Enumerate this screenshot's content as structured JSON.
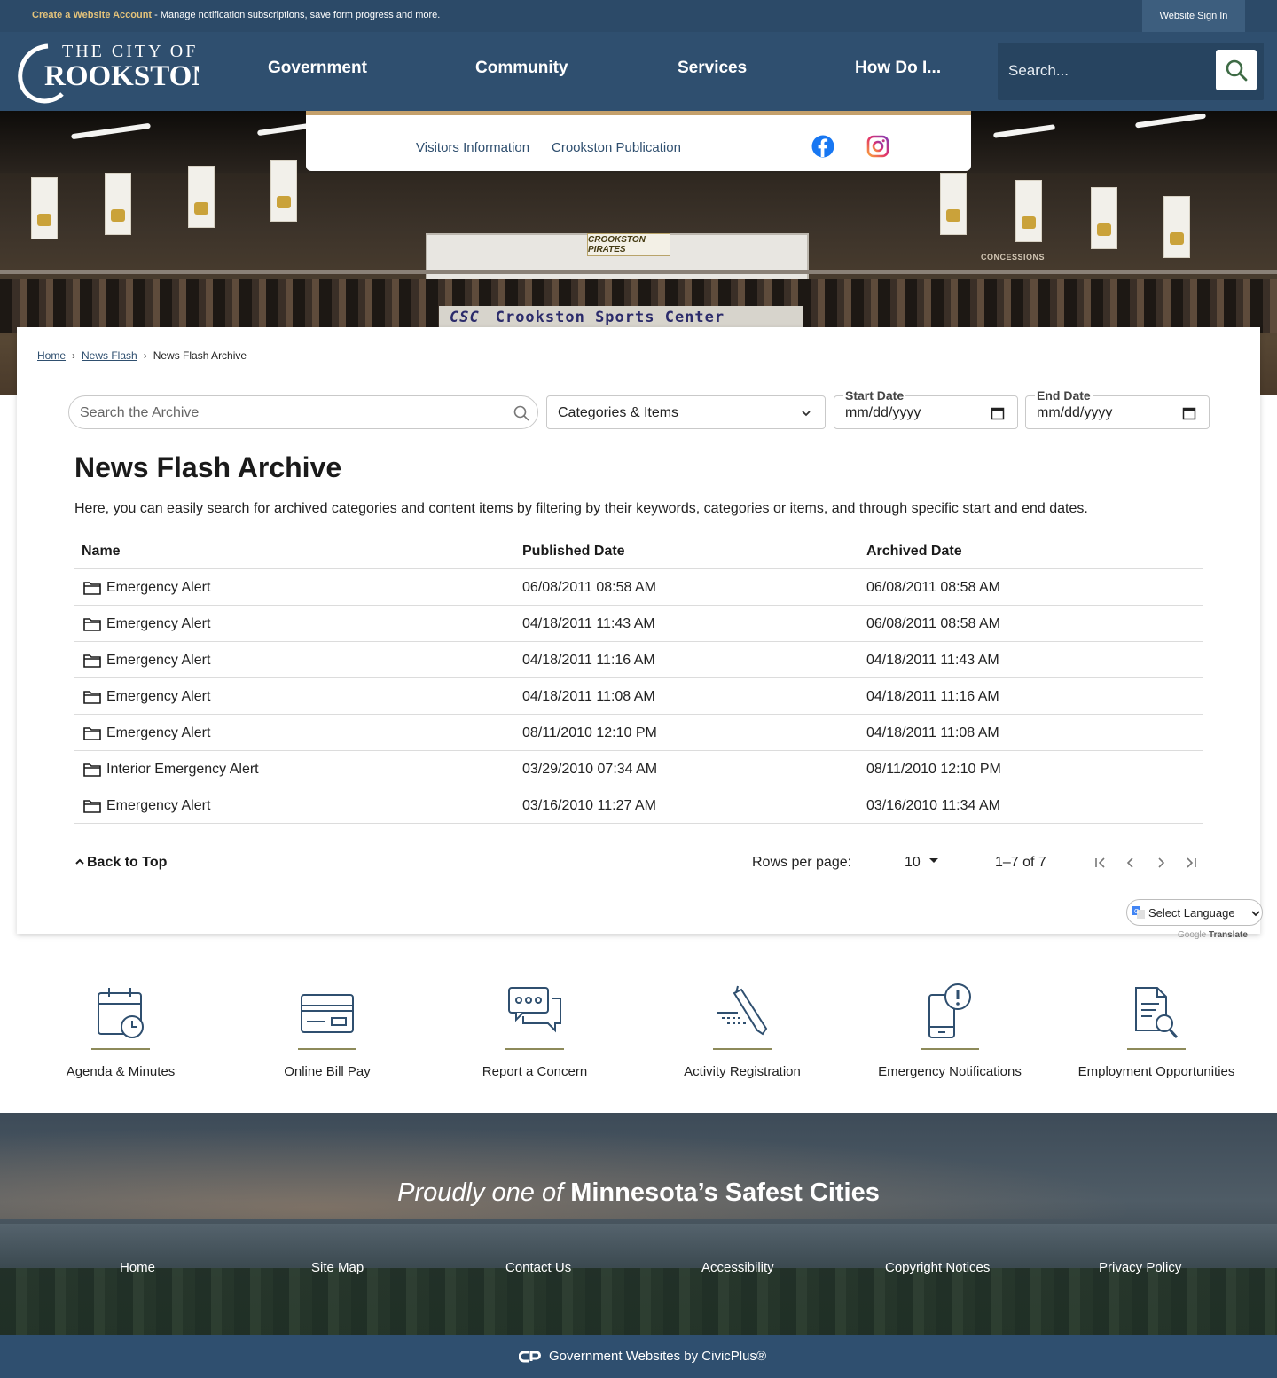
{
  "topbar": {
    "create_link": "Create a Website Account",
    "message": " - Manage notification subscriptions, save form progress and more.",
    "signin_label": "Website Sign In"
  },
  "header": {
    "logo_line1": "THE CITY OF",
    "logo_line2": "ROOKSTON",
    "logo_initial": "C",
    "nav": [
      "Government",
      "Community",
      "Services",
      "How Do I..."
    ],
    "search_placeholder": "Search..."
  },
  "hero": {
    "sign_text": "Crookston Sports Center",
    "sign_prefix": "CSC",
    "booth_text": "CROOKSTON PIRATES",
    "concessions": "CONCESSIONS"
  },
  "quick_links": {
    "items": [
      "Visitors Information",
      "Crookston Publication"
    ],
    "social": [
      "facebook-icon",
      "instagram-icon"
    ]
  },
  "breadcrumb": {
    "home": "Home",
    "news_flash": "News Flash",
    "current": "News Flash Archive",
    "separator": "›"
  },
  "filters": {
    "search_placeholder": "Search the Archive",
    "categories_label": "Categories & Items",
    "start_label": "Start Date",
    "end_label": "End Date",
    "date_placeholder": "mm/dd/yyyy"
  },
  "page": {
    "title": "News Flash Archive",
    "intro": "Here, you can easily search for archived categories and content items by filtering by their keywords, categories or items, and through specific start and end dates."
  },
  "table": {
    "headers": [
      "Name",
      "Published Date",
      "Archived Date"
    ],
    "rows": [
      [
        "Emergency Alert",
        "06/08/2011 08:58 AM",
        "06/08/2011 08:58 AM"
      ],
      [
        "Emergency Alert",
        "04/18/2011 11:43 AM",
        "06/08/2011 08:58 AM"
      ],
      [
        "Emergency Alert",
        "04/18/2011 11:16 AM",
        "04/18/2011 11:43 AM"
      ],
      [
        "Emergency Alert",
        "04/18/2011 11:08 AM",
        "04/18/2011 11:16 AM"
      ],
      [
        "Emergency Alert",
        "08/11/2010 12:10 PM",
        "04/18/2011 11:08 AM"
      ],
      [
        "Interior Emergency Alert",
        "03/29/2010 07:34 AM",
        "08/11/2010 12:10 PM"
      ],
      [
        "Emergency Alert",
        "03/16/2010 11:27 AM",
        "03/16/2010 11:34 AM"
      ]
    ]
  },
  "pagination": {
    "back_to_top": "Back to Top",
    "rows_per_page_label": "Rows per page:",
    "rows_per_page": "10",
    "range": "1–7 of 7"
  },
  "translate": {
    "select_label": "Select Language",
    "powered_google": "Google",
    "powered_translate": "Translate"
  },
  "quick_icons": [
    {
      "label": "Agenda & Minutes",
      "icon": "calendar-clock-icon"
    },
    {
      "label": "Online Bill Pay",
      "icon": "credit-card-icon"
    },
    {
      "label": "Report a Concern",
      "icon": "chat-bubbles-icon"
    },
    {
      "label": "Activity Registration",
      "icon": "pen-signature-icon"
    },
    {
      "label": "Emergency Notifications",
      "icon": "phone-alert-icon"
    },
    {
      "label": "Employment Opportunities",
      "icon": "document-search-icon"
    }
  ],
  "footer": {
    "tagline_italic": "Proudly one of",
    "tagline_bold": "Minnesota’s Safest Cities",
    "links": [
      "Home",
      "Site Map",
      "Contact Us",
      "Accessibility",
      "Copyright Notices",
      "Privacy Policy"
    ],
    "civicplus": "Government Websites by CivicPlus®"
  },
  "colors": {
    "primary_navy": "#2f4f6f",
    "accent_tan": "#c4a06b",
    "icon_underline": "#8d8a5a"
  }
}
